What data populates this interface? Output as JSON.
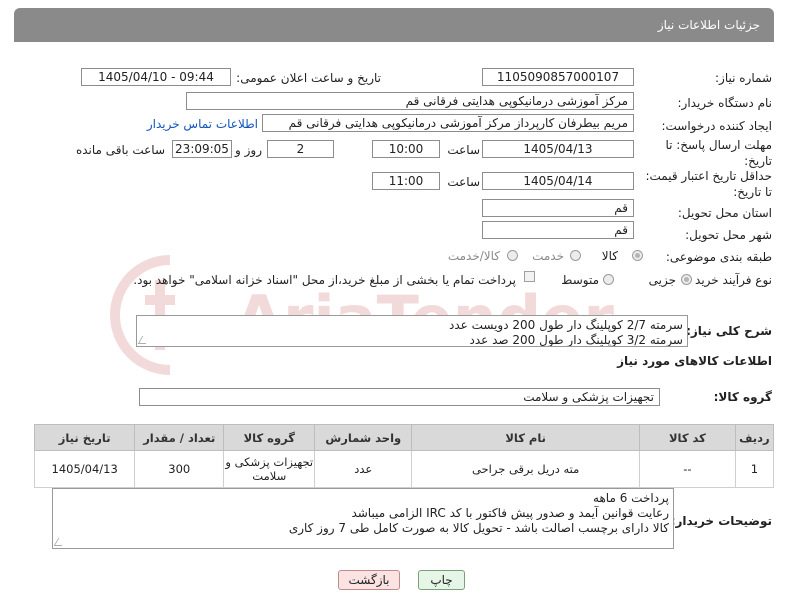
{
  "header": {
    "title": "جزئیات اطلاعات نیاز"
  },
  "fields": {
    "need_number_label": "شماره نیاز:",
    "need_number": "1105090857000107",
    "announce_label": "تاریخ و ساعت اعلان عمومی:",
    "announce_value": "1405/04/10 - 09:44",
    "buyer_org_label": "نام دستگاه خریدار:",
    "buyer_org": "مرکز آموزشی درمانیکوپی هدایتی فرقانی قم",
    "creator_label": "ایجاد کننده درخواست:",
    "creator": "مریم بیطرفان کارپرداز مرکز آموزشی درمانیکوپی هدایتی فرقانی قم",
    "contact_link": "اطلاعات تماس خریدار",
    "deadline_label": "مهلت ارسال پاسخ: تا تاریخ:",
    "deadline_date": "1405/04/13",
    "time_label": "ساعت",
    "deadline_time": "10:00",
    "days_value": "2",
    "days_label": "روز و",
    "remaining_time": "23:09:05",
    "remaining_label": "ساعت باقی مانده",
    "validity_label": "حداقل تاریخ اعتبار قیمت: تا تاریخ:",
    "validity_date": "1405/04/14",
    "validity_time": "11:00",
    "province_label": "استان محل تحویل:",
    "province": "قم",
    "city_label": "شهر محل تحویل:",
    "city": "قم",
    "category_label": "طبقه بندی موضوعی:",
    "category_options": [
      "کالا",
      "خدمت",
      "کالا/خدمت"
    ],
    "process_label": "نوع فرآیند خرید :",
    "process_options": [
      "جزیی",
      "متوسط"
    ],
    "payment_note": "پرداخت تمام یا بخشی از مبلغ خرید،از محل \"اسناد خزانه اسلامی\" خواهد بود.",
    "description_label": "شرح کلی نیاز:",
    "description_lines": [
      "سرمته 2/7 کوپلینگ دار طول 200 دویست عدد",
      "سرمته 3/2 کوپلینگ دار طول 200 صد عدد"
    ]
  },
  "goods": {
    "section_title": "اطلاعات کالاهای مورد نیاز",
    "group_label": "گروه کالا:",
    "group_value": "تجهیزات پزشکی و سلامت",
    "columns": [
      "ردیف",
      "کد کالا",
      "نام کالا",
      "واحد شمارش",
      "گروه کالا",
      "تعداد / مقدار",
      "تاریخ نیاز"
    ],
    "rows": [
      {
        "row": "1",
        "code": "--",
        "name": "مته دریل برقی جراحی",
        "unit": "عدد",
        "group": "تجهیزات پزشکی و سلامت",
        "qty": "300",
        "date": "1405/04/13"
      }
    ]
  },
  "buyer_notes": {
    "label": "توضیحات خریدار:",
    "lines": [
      "پرداخت 6 ماهه",
      "رعایت قوانین آیمد و صدور پیش فاکتور با کد IRC الزامی میباشد",
      "کالا دارای برچسب اصالت باشد - تحویل  کالا به صورت کامل طی 7 روز کاری"
    ]
  },
  "buttons": {
    "print": "چاپ",
    "back": "بازگشت"
  },
  "watermark_text": "AriaTender.neT",
  "colors": {
    "header_bg": "#8a8a8a",
    "link": "#1155bb",
    "print_btn": "#e6f6e6",
    "back_btn": "#fbe3e3"
  }
}
